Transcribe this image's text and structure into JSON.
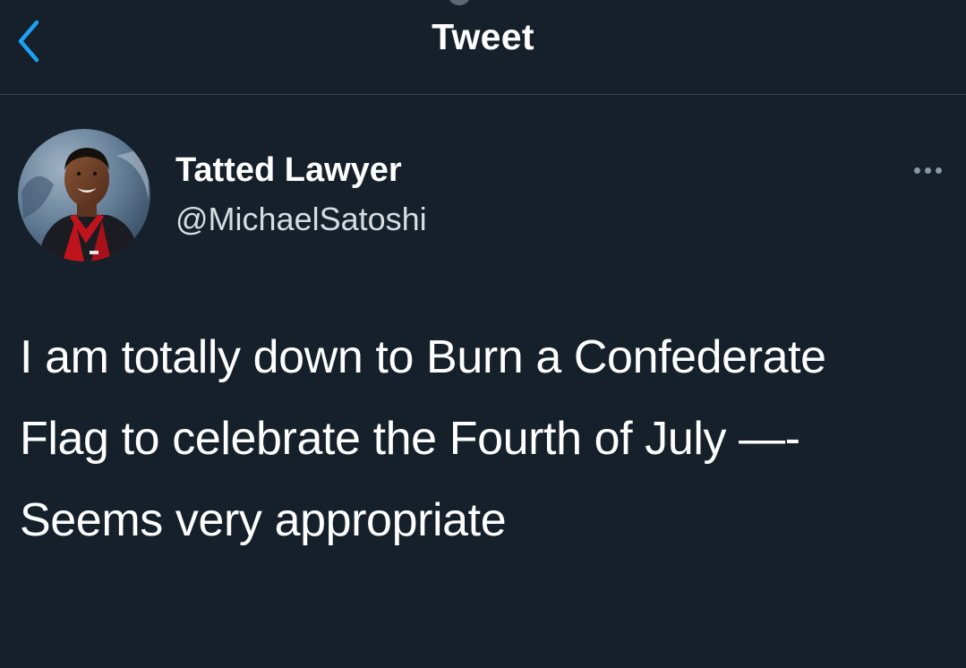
{
  "header": {
    "title": "Tweet",
    "back_icon": "chevron-left-icon"
  },
  "tweet": {
    "author": {
      "display_name": "Tatted Lawyer",
      "handle": "@MichaelSatoshi"
    },
    "text": "I am totally down to Burn a Confederate Flag to celebrate the Fourth of July —- Seems very appropriate",
    "more_icon": "more-options-icon"
  },
  "colors": {
    "background": "#15202b",
    "accent": "#1da1f2",
    "divider": "#38444d",
    "secondary_text": "#8899a6"
  }
}
